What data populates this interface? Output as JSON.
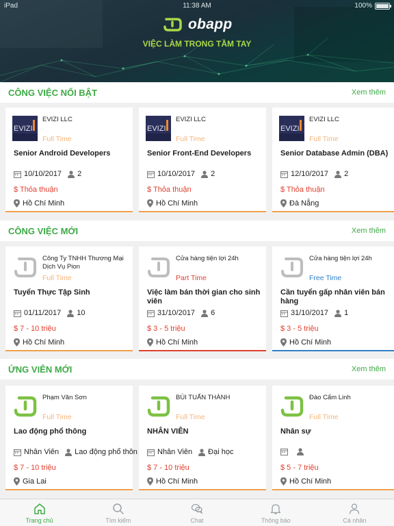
{
  "status_bar": {
    "left": "iPad",
    "time": "11:38 AM",
    "battery": "100%"
  },
  "header": {
    "brand": "obapp",
    "tagline": "VIỆC LÀM TRONG TẦM TAY"
  },
  "colors": {
    "accent": "#3eaa46",
    "salary": "#e0402f",
    "fulltime": "#f5b57a",
    "parttime": "#e0402f",
    "freetime": "#2f7fc5"
  },
  "sections": [
    {
      "title": "CÔNG VIỆC NỔI BẬT",
      "more": "Xem thêm",
      "cards": [
        {
          "company": "EVIZI LLC",
          "logo": "evizi-logo",
          "type": "Full Time",
          "title": "Senior Android Developers",
          "date": "10/10/2017",
          "count": "2",
          "salary": "$ Thỏa thuận",
          "location": "Hồ Chí Minh"
        },
        {
          "company": "EVIZI LLC",
          "logo": "evizi-logo",
          "type": "Full Time",
          "title": "Senior Front-End Developers",
          "date": "10/10/2017",
          "count": "2",
          "salary": "$ Thỏa thuận",
          "location": "Hồ Chí Minh"
        },
        {
          "company": "EVIZI LLC",
          "logo": "evizi-logo",
          "type": "Full Time",
          "title": "Senior Database Admin (DBA)",
          "date": "12/10/2017",
          "count": "2",
          "salary": "$ Thỏa thuận",
          "location": "Đà Nẵng"
        }
      ]
    },
    {
      "title": "CÔNG VIỆC MỚI",
      "more": "Xem thêm",
      "cards": [
        {
          "company": "Công Ty TNHH Thương Mại Dịch Vụ Pion",
          "logo": "jobapp-grey-logo",
          "type": "Full Time",
          "title": "Tuyển Thực Tập Sinh",
          "date": "01/11/2017",
          "count": "10",
          "salary": "$ 7 - 10 triệu",
          "location": "Hồ Chí Minh"
        },
        {
          "company": "Cửa hàng tiện lợi 24h",
          "logo": "jobapp-grey-logo",
          "type": "Part Time",
          "title": "Việc làm bán thời gian cho sinh viên",
          "date": "31/10/2017",
          "count": "6",
          "salary": "$ 3 - 5 triệu",
          "location": "Hồ Chí Minh"
        },
        {
          "company": "Cửa hàng tiện lợi 24h",
          "logo": "jobapp-grey-logo",
          "type": "Free Time",
          "title": "Cần tuyển gấp nhân viên bán hàng",
          "date": "31/10/2017",
          "count": "1",
          "salary": "$ 3 - 5 triệu",
          "location": "Hồ Chí Minh"
        }
      ]
    },
    {
      "title": "ỨNG VIÊN MỚI",
      "more": "Xem thêm",
      "cards": [
        {
          "company": "Phạm Văn Sơn",
          "logo": "jobapp-green-logo",
          "type": "Full Time",
          "title": "Lao động phổ thông",
          "date": "Nhân Viên",
          "count": "Lao động phổ thôn",
          "salary": "$ 7 - 10 triệu",
          "location": "Gia Lai"
        },
        {
          "company": "BÙI TUẤN THÀNH",
          "logo": "jobapp-green-logo",
          "type": "Full Time",
          "title": "NHÂN VIÊN",
          "date": "Nhân Viên",
          "count": "Đại học",
          "salary": "$ 7 - 10 triệu",
          "location": "Hồ Chí Minh"
        },
        {
          "company": "Đào Cẩm Linh",
          "logo": "jobapp-green-logo",
          "type": "Full Time",
          "title": "Nhân sự",
          "date": "",
          "count": "",
          "salary": "$ 5 - 7 triệu",
          "location": "Hồ Chí Minh"
        }
      ]
    }
  ],
  "tabs": [
    {
      "label": "Trang chủ",
      "icon": "home-icon",
      "active": true
    },
    {
      "label": "Tìm kiếm",
      "icon": "search-icon",
      "active": false
    },
    {
      "label": "Chat",
      "icon": "chat-icon",
      "active": false
    },
    {
      "label": "Thông báo",
      "icon": "bell-icon",
      "active": false
    },
    {
      "label": "Cá nhân",
      "icon": "user-icon",
      "active": false
    }
  ]
}
